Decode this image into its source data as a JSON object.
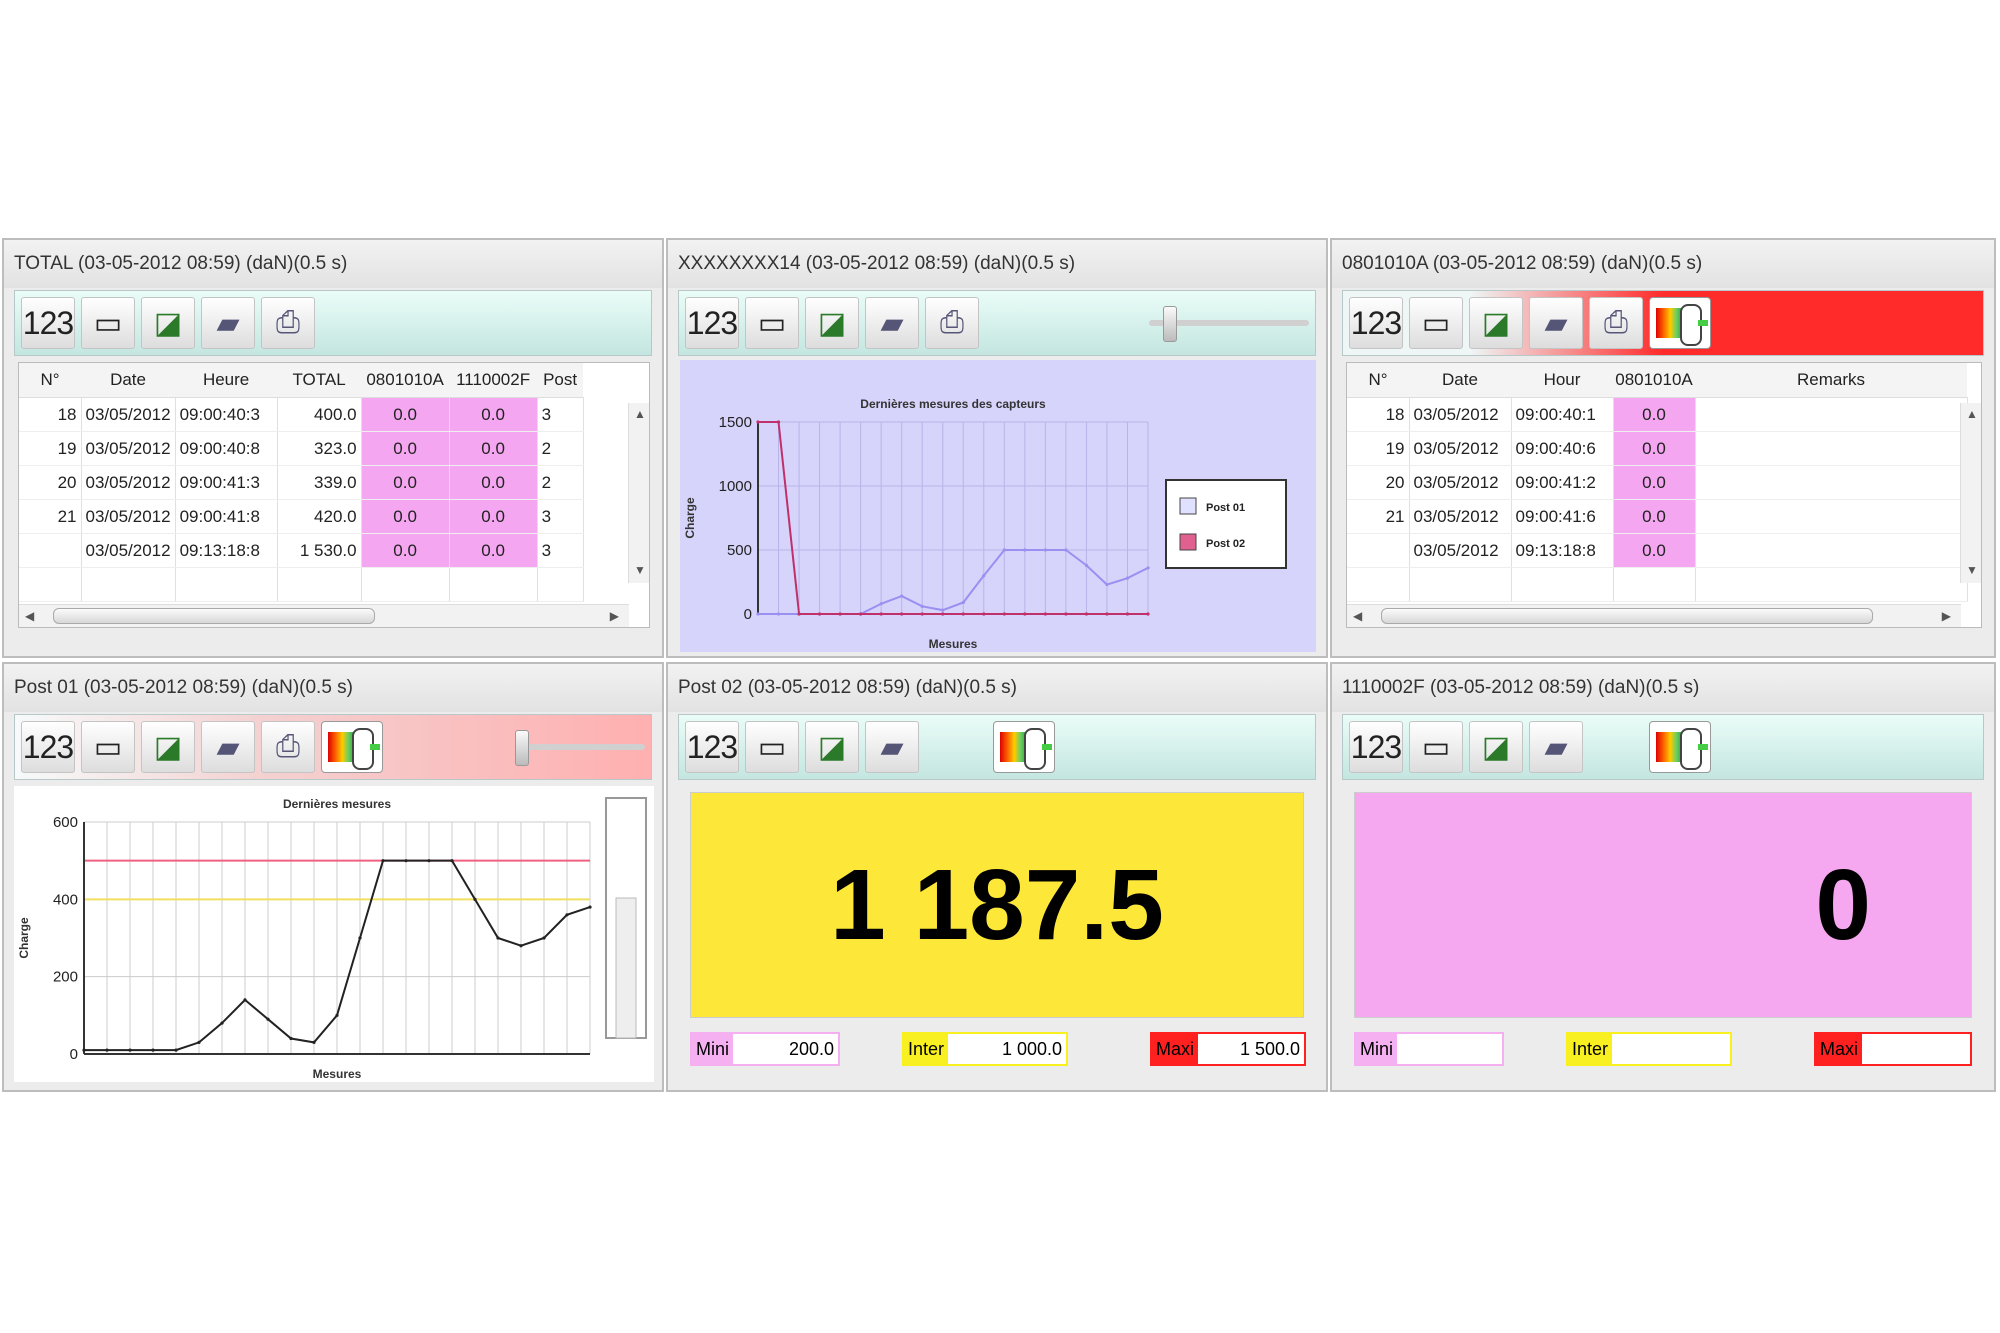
{
  "windows": {
    "total": {
      "title": "TOTAL (03-05-2012 08:59) (daN)(0.5 s)",
      "columns": [
        "N°",
        "Date",
        "Heure",
        "TOTAL",
        "0801010A",
        "1110002F",
        "Post"
      ],
      "rows": [
        [
          "18",
          "03/05/2012",
          "09:00:40:3",
          "400.0",
          "0.0",
          "0.0",
          "3"
        ],
        [
          "19",
          "03/05/2012",
          "09:00:40:8",
          "323.0",
          "0.0",
          "0.0",
          "2"
        ],
        [
          "20",
          "03/05/2012",
          "09:00:41:3",
          "339.0",
          "0.0",
          "0.0",
          "2"
        ],
        [
          "21",
          "03/05/2012",
          "09:00:41:8",
          "420.0",
          "0.0",
          "0.0",
          "3"
        ],
        [
          "",
          "03/05/2012",
          "09:13:18:8",
          "1 530.0",
          "0.0",
          "0.0",
          "3"
        ]
      ]
    },
    "xxx": {
      "title": "XXXXXXXX14 (03-05-2012 08:59) (daN)(0.5 s)"
    },
    "sensor_a": {
      "title": "0801010A (03-05-2012 08:59) (daN)(0.5 s)",
      "columns": [
        "N°",
        "Date",
        "Hour",
        "0801010A",
        "Remarks"
      ],
      "rows": [
        [
          "18",
          "03/05/2012",
          "09:00:40:1",
          "0.0",
          ""
        ],
        [
          "19",
          "03/05/2012",
          "09:00:40:6",
          "0.0",
          ""
        ],
        [
          "20",
          "03/05/2012",
          "09:00:41:2",
          "0.0",
          ""
        ],
        [
          "21",
          "03/05/2012",
          "09:00:41:6",
          "0.0",
          ""
        ],
        [
          "",
          "03/05/2012",
          "09:13:18:8",
          "0.0",
          ""
        ]
      ]
    },
    "post01": {
      "title": "Post 01 (03-05-2012 08:59) (daN)(0.5 s)"
    },
    "post02": {
      "title": "Post 02 (03-05-2012 08:59) (daN)(0.5 s)",
      "value": "1 187.5",
      "min_label": "Mini",
      "min_value": "200.0",
      "inter_label": "Inter",
      "inter_value": "1 000.0",
      "maxi_label": "Maxi",
      "maxi_value": "1 500.0",
      "panel_color": "#fde83a"
    },
    "sensor_f": {
      "title": "1110002F (03-05-2012 08:59) (daN)(0.5 s)",
      "value": "0",
      "min_label": "Mini",
      "min_value": "",
      "inter_label": "Inter",
      "inter_value": "",
      "maxi_label": "Maxi",
      "maxi_value": "",
      "panel_color": "#f5a8f0"
    }
  },
  "toolbar": {
    "numeric_label": "123",
    "icons": [
      "numeric-display-icon",
      "table-icon",
      "chart-icon",
      "camera-icon",
      "print-icon",
      "gauge-icon"
    ]
  },
  "colors": {
    "pink_cell": "#f4a6f0",
    "yellow_panel": "#fde83a",
    "pink_panel": "#f5a8f0",
    "red_threshold": "#ff2020",
    "chart_bg": "#d6d4fb"
  },
  "chart_data": [
    {
      "type": "line",
      "title": "Dernières mesures des capteurs",
      "xlabel": "Mesures",
      "ylabel": "Charge",
      "ylim": [
        0,
        1500
      ],
      "yticks": [
        0,
        500,
        1000,
        1500
      ],
      "legend": "right",
      "x": [
        1,
        2,
        3,
        4,
        5,
        6,
        7,
        8,
        9,
        10,
        11,
        12,
        13,
        14,
        15,
        16,
        17,
        18,
        19,
        20
      ],
      "series": [
        {
          "name": "Post 01",
          "color": "#9a90f0",
          "values": [
            0,
            0,
            0,
            0,
            0,
            0,
            80,
            140,
            60,
            30,
            90,
            300,
            500,
            500,
            500,
            500,
            380,
            230,
            280,
            360
          ]
        },
        {
          "name": "Post 02",
          "color": "#c0306a",
          "values": [
            1500,
            1500,
            0,
            0,
            0,
            0,
            0,
            0,
            0,
            0,
            0,
            0,
            0,
            0,
            0,
            0,
            0,
            0,
            0,
            0
          ]
        }
      ]
    },
    {
      "type": "line",
      "title": "Dernières mesures",
      "xlabel": "Mesures",
      "ylabel": "Charge",
      "ylim": [
        0,
        600
      ],
      "yticks": [
        0,
        200,
        400,
        600
      ],
      "thresholds": [
        {
          "value": 500,
          "color": "#f06080"
        },
        {
          "value": 400,
          "color": "#f0e060"
        }
      ],
      "x": [
        1,
        2,
        3,
        4,
        5,
        6,
        7,
        8,
        9,
        10,
        11,
        12,
        13,
        14,
        15,
        16,
        17,
        18,
        19,
        20,
        21,
        22,
        23
      ],
      "series": [
        {
          "color": "#222222",
          "values": [
            10,
            10,
            10,
            10,
            10,
            30,
            80,
            140,
            90,
            40,
            30,
            100,
            300,
            500,
            500,
            500,
            500,
            400,
            300,
            280,
            300,
            360,
            380
          ]
        }
      ]
    }
  ]
}
